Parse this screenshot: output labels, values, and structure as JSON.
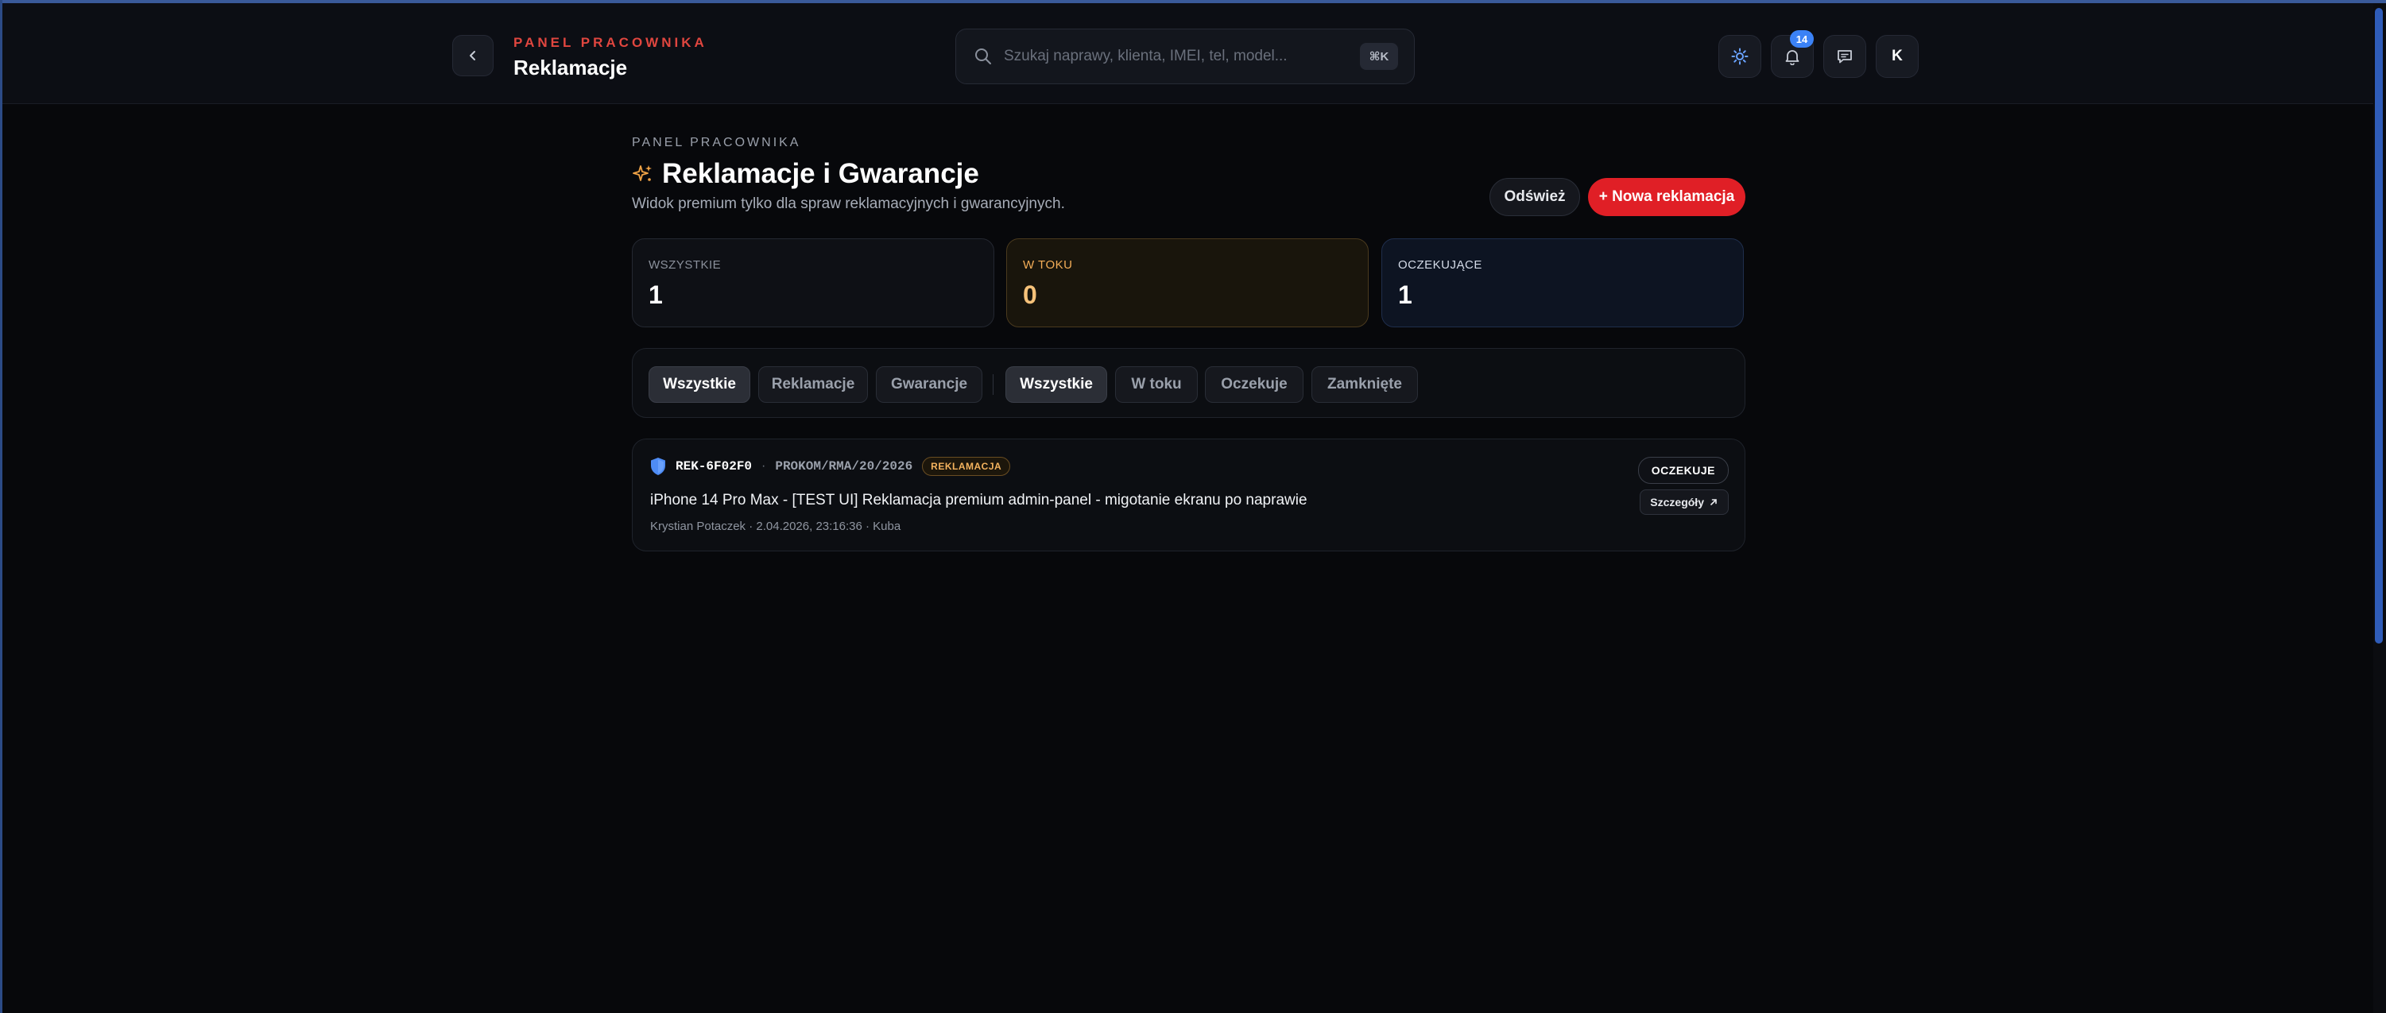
{
  "header": {
    "kicker": "PANEL PRACOWNIKA",
    "title": "Reklamacje",
    "search_placeholder": "Szukaj naprawy, klienta, IMEI, tel, model...",
    "search_shortcut": "⌘K",
    "notification_count": "14",
    "avatar_initial": "K"
  },
  "page": {
    "kicker": "PANEL PRACOWNIKA",
    "title": "Reklamacje i Gwarancje",
    "subtitle": "Widok premium tylko dla spraw reklamacyjnych i gwarancyjnych.",
    "refresh_label": "Odśwież",
    "new_label": "+ Nowa reklamacja"
  },
  "stats": [
    {
      "label": "WSZYSTKIE",
      "value": "1"
    },
    {
      "label": "W TOKU",
      "value": "0"
    },
    {
      "label": "OCZEKUJĄCE",
      "value": "1"
    }
  ],
  "filters": {
    "type": [
      "Wszystkie",
      "Reklamacje",
      "Gwarancje"
    ],
    "status": [
      "Wszystkie",
      "W toku",
      "Oczekuje",
      "Zamknięte"
    ]
  },
  "cases": [
    {
      "id": "REK-6F02F0",
      "rma": "PROKOM/RMA/20/2026",
      "tag": "REKLAMACJA",
      "title": "iPhone 14 Pro Max - [TEST UI] Reklamacja premium admin-panel - migotanie ekranu po naprawie",
      "meta": "Krystian Potaczek · 2.04.2026, 23:16:36 · Kuba",
      "status": "OCZEKUJE",
      "details_label": "Szczegóły"
    }
  ],
  "colors": {
    "accent_red": "#e01f26",
    "kicker_red": "#e0463f",
    "in_progress": "#f3ad57",
    "badge_blue": "#3b82f6"
  }
}
